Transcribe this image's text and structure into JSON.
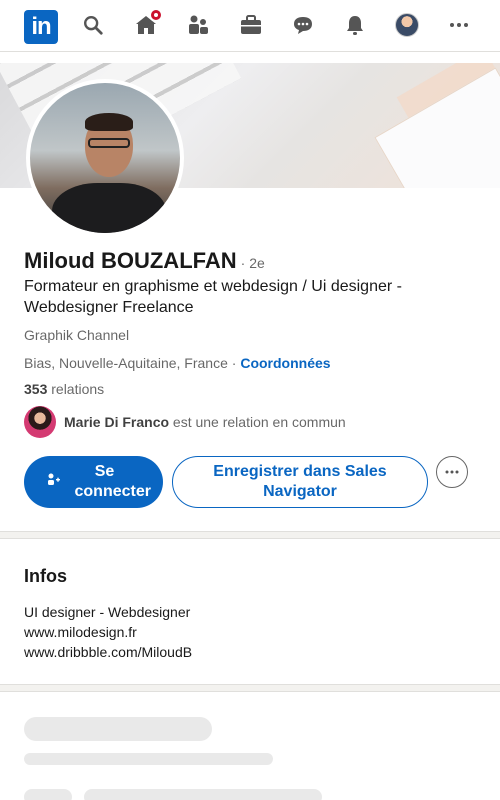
{
  "nav": {
    "logo_text": "in",
    "icons": [
      "search-icon",
      "home-icon",
      "my-network-icon",
      "jobs-icon",
      "messaging-icon",
      "notifications-icon",
      "me-avatar",
      "more-icon"
    ],
    "brand_color": "#0a66c2",
    "badge_color": "#cb112d"
  },
  "profile": {
    "name": "Miloud BOUZALFAN",
    "degree": "· 2e",
    "headline": "Formateur en graphisme et webdesign / Ui designer - Webdesigner Freelance",
    "company": "Graphik Channel",
    "location": "Bias, Nouvelle-Aquitaine, France · ",
    "contact_link": "Coordonnées",
    "connections_count": "353",
    "connections_label": " relations",
    "mutual_name": "Marie Di Franco",
    "mutual_text": " est une relation en commun"
  },
  "actions": {
    "connect_label": "Se connecter",
    "sales_label": "Enregistrer dans Sales Navigator"
  },
  "about": {
    "title": "Infos",
    "lines": [
      "UI designer - Webdesigner",
      "www.milodesign.fr",
      "www.dribbble.com/MiloudB"
    ]
  }
}
